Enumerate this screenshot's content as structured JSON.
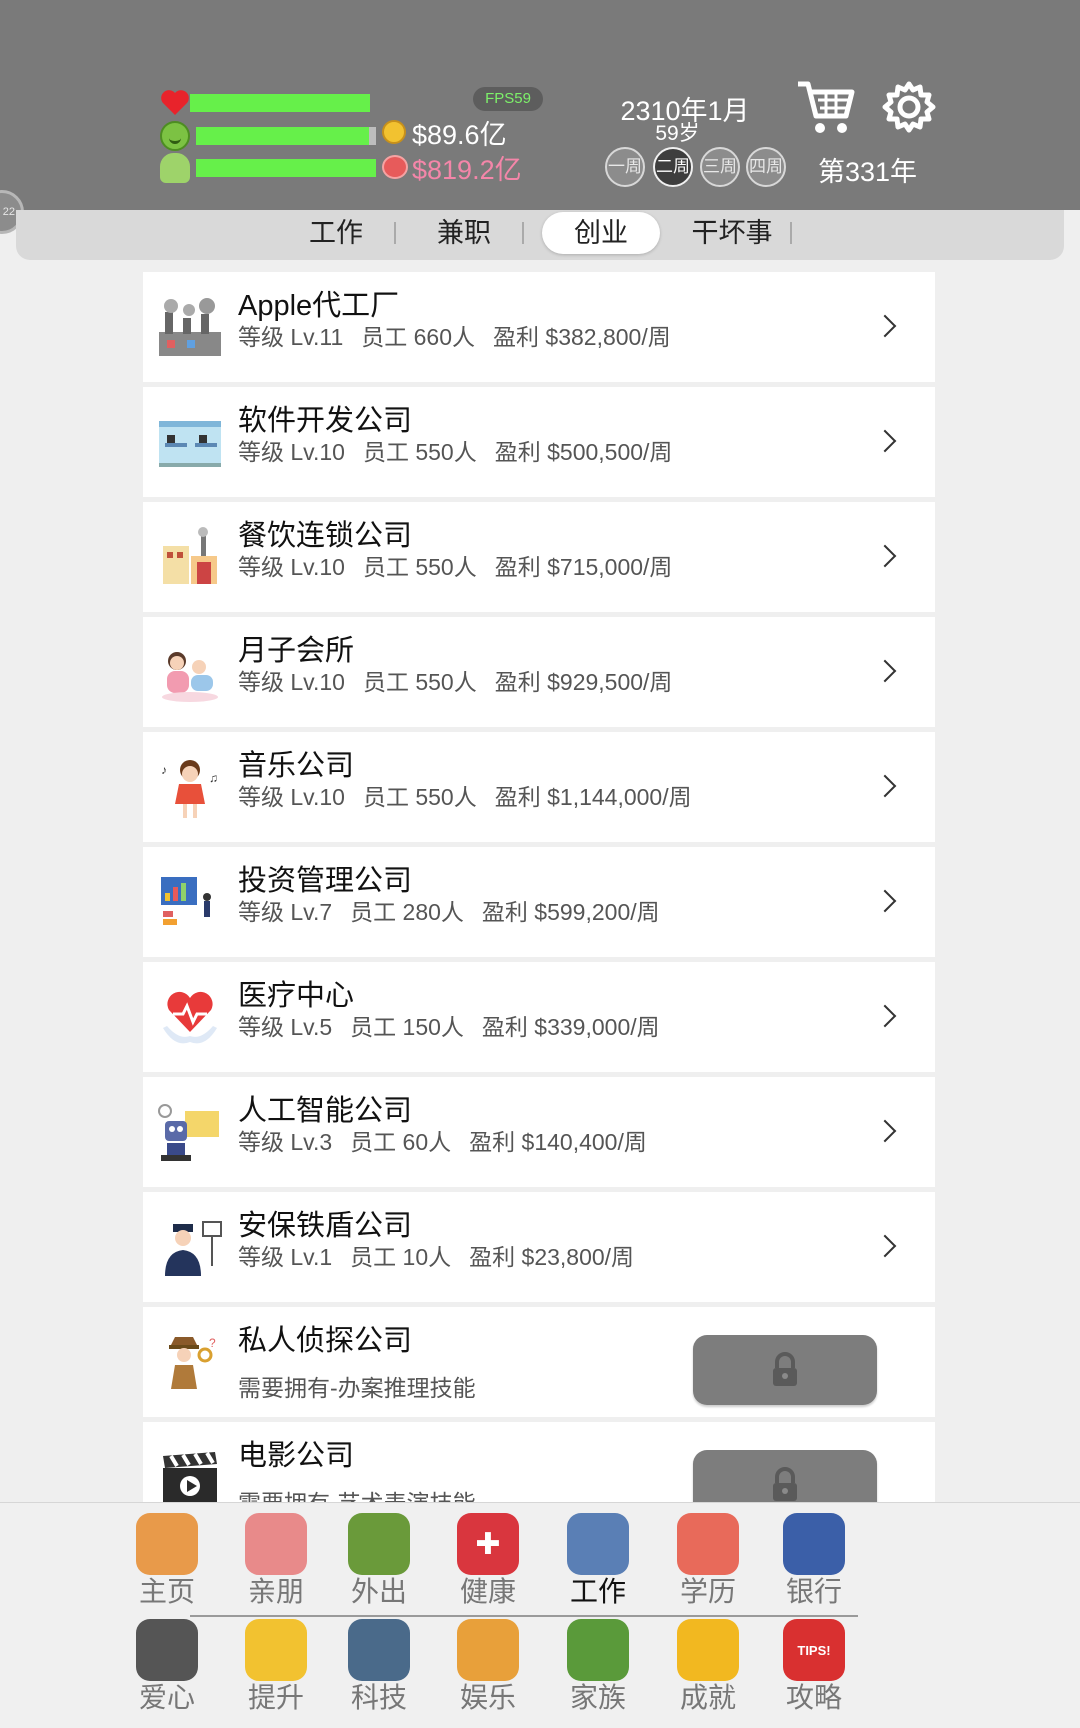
{
  "header": {
    "fps": "FPS59",
    "health_level": 1.0,
    "mood_level": 0.96,
    "intellect_level": 1.0,
    "money": "$89.6亿",
    "assets": "$819.2亿",
    "date": "2310年1月",
    "age": "59岁",
    "weeks": [
      "一周",
      "二周",
      "三周",
      "四周"
    ],
    "active_week": 1,
    "year_count": "第331年",
    "side_tab": "22"
  },
  "tabs": [
    {
      "label": "工作",
      "active": false
    },
    {
      "label": "兼职",
      "active": false
    },
    {
      "label": "创业",
      "active": true
    },
    {
      "label": "干坏事",
      "active": false
    }
  ],
  "businesses": [
    {
      "name": "Apple代工厂",
      "level": "等级 Lv.11",
      "staff": "员工 660人",
      "profit": "盈利 $382,800/周",
      "icon": "factory-icon"
    },
    {
      "name": "软件开发公司",
      "level": "等级 Lv.10",
      "staff": "员工 550人",
      "profit": "盈利 $500,500/周",
      "icon": "office-icon"
    },
    {
      "name": "餐饮连锁公司",
      "level": "等级 Lv.10",
      "staff": "员工 550人",
      "profit": "盈利 $715,000/周",
      "icon": "restaurant-icon"
    },
    {
      "name": "月子会所",
      "level": "等级 Lv.10",
      "staff": "员工 550人",
      "profit": "盈利 $929,500/周",
      "icon": "mother-baby-icon"
    },
    {
      "name": "音乐公司",
      "level": "等级 Lv.10",
      "staff": "员工 550人",
      "profit": "盈利 $1,144,000/周",
      "icon": "singer-icon"
    },
    {
      "name": "投资管理公司",
      "level": "等级 Lv.7",
      "staff": "员工 280人",
      "profit": "盈利 $599,200/周",
      "icon": "investment-icon"
    },
    {
      "name": "医疗中心",
      "level": "等级 Lv.5",
      "staff": "员工 150人",
      "profit": "盈利 $339,000/周",
      "icon": "heart-hands-icon"
    },
    {
      "name": "人工智能公司",
      "level": "等级 Lv.3",
      "staff": "员工 60人",
      "profit": "盈利 $140,400/周",
      "icon": "robot-icon"
    },
    {
      "name": "安保铁盾公司",
      "level": "等级 Lv.1",
      "staff": "员工 10人",
      "profit": "盈利 $23,800/周",
      "icon": "security-guard-icon"
    }
  ],
  "locked_businesses": [
    {
      "name": "私人侦探公司",
      "requirement": "需要拥有-办案推理技能",
      "icon": "detective-icon"
    },
    {
      "name": "电影公司",
      "requirement": "需要拥有-艺术表演技能",
      "icon": "clapperboard-icon"
    }
  ],
  "nav_row1": [
    {
      "label": "主页",
      "icon": "home-icon",
      "color": "#e89a4a",
      "active": false
    },
    {
      "label": "亲朋",
      "icon": "handshake-icon",
      "color": "#e88a8a",
      "active": false
    },
    {
      "label": "外出",
      "icon": "tent-icon",
      "color": "#6a9a3a",
      "active": false
    },
    {
      "label": "健康",
      "icon": "red-cross-icon",
      "color": "#d9363e",
      "active": false
    },
    {
      "label": "工作",
      "icon": "worker-icon",
      "color": "#5a7fb5",
      "active": true
    },
    {
      "label": "学历",
      "icon": "study-icon",
      "color": "#e86a5a",
      "active": false
    },
    {
      "label": "银行",
      "icon": "bank-icon",
      "color": "#3b5fa8",
      "active": false
    }
  ],
  "nav_row2": [
    {
      "label": "爱心",
      "icon": "husky-icon",
      "color": "#555555",
      "active": false
    },
    {
      "label": "提升",
      "icon": "bulb-icon",
      "color": "#f2c230",
      "active": false
    },
    {
      "label": "科技",
      "icon": "scientist-icon",
      "color": "#4a6a8a",
      "active": false
    },
    {
      "label": "娱乐",
      "icon": "trophy-cup-icon",
      "color": "#e8a03a",
      "active": false
    },
    {
      "label": "家族",
      "icon": "family-tree-icon",
      "color": "#5a9a3a",
      "active": false
    },
    {
      "label": "成就",
      "icon": "trophy-icon",
      "color": "#f2b820",
      "active": false
    },
    {
      "label": "攻略",
      "icon": "tips-icon",
      "color": "#d93030",
      "active": false
    }
  ],
  "tips_badge": "TIPS!",
  "colors": {
    "header_bg": "#7a7a7a",
    "bar_fill": "#66f04a",
    "assets_pink": "#f486a9"
  }
}
